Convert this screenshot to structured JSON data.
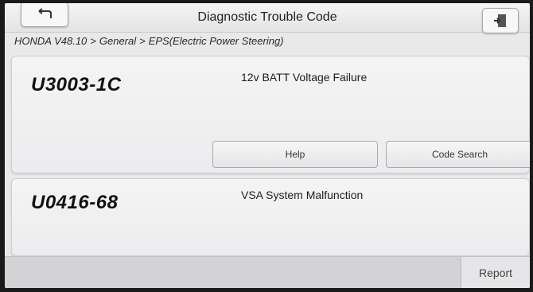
{
  "header": {
    "title": "Diagnostic Trouble Code",
    "back_icon": "back-arrow-icon",
    "exit_icon": "exit-door-icon"
  },
  "breadcrumb": {
    "items": [
      "HONDA V48.10",
      "General",
      "EPS(Electric Power Steering)"
    ],
    "separator": ">"
  },
  "dtc_list": [
    {
      "code": "U3003-1C",
      "description": "12v BATT Voltage Failure",
      "help_label": "Help",
      "code_search_label": "Code Search"
    },
    {
      "code": "U0416-68",
      "description": "VSA System Malfunction"
    }
  ],
  "footer": {
    "report_label": "Report"
  }
}
